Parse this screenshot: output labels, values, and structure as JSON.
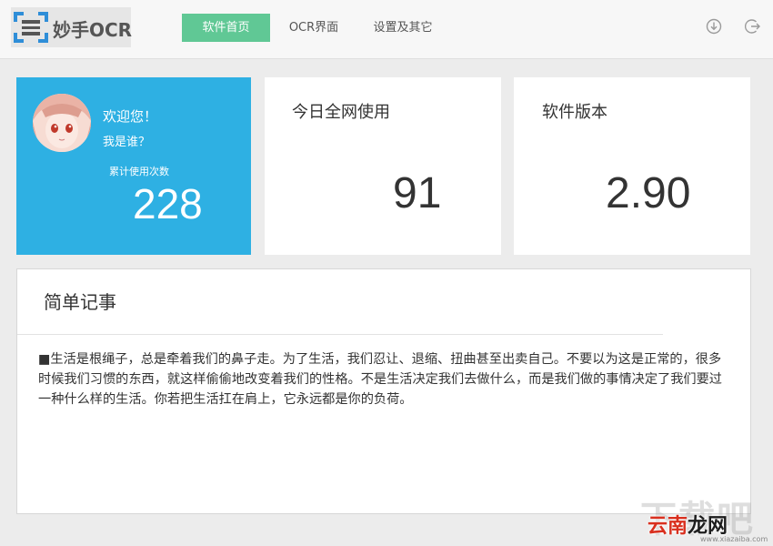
{
  "header": {
    "logo_text": "妙手OCR",
    "tabs": [
      {
        "label": "软件首页",
        "active": true
      },
      {
        "label": "OCR界面",
        "active": false
      },
      {
        "label": "设置及其它",
        "active": false
      }
    ],
    "icons": [
      "download-icon",
      "logout-icon"
    ]
  },
  "welcome_card": {
    "greeting": "欢迎您！",
    "who": "我是谁？",
    "count_label": "累计使用次数",
    "count_value": "228",
    "color": "#2eb0e3"
  },
  "usage_card": {
    "title": "今日全网使用",
    "value": "91"
  },
  "version_card": {
    "title": "软件版本",
    "value": "2.90"
  },
  "notes": {
    "title": "简单记事",
    "body": "■生活是根绳子，总是牵着我们的鼻子走。为了生活，我们忍让、退缩、扭曲甚至出卖自己。不要以为这是正常的，很多时候我们习惯的东西，就这样偷偷地改变着我们的性格。不是生活决定我们去做什么，而是我们做的事情决定了我们要过一种什么样的生活。你若把生活扛在肩上，它永远都是你的负荷。"
  },
  "watermark": {
    "big_text": "下载吧",
    "brand_red": "云南",
    "brand_dark": "龙网",
    "url": "www.xiazaiba.com"
  },
  "colors": {
    "accent_green": "#60c895",
    "welcome_blue": "#2eb0e3"
  }
}
